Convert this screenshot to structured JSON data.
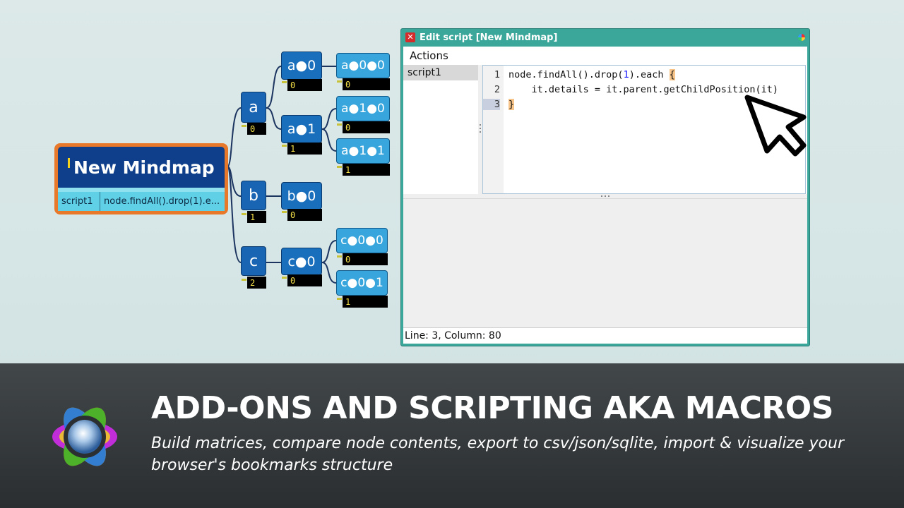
{
  "mindmap": {
    "root": {
      "title": "New Mindmap",
      "attr_key": "script1",
      "attr_value": "node.findAll().drop(1).e..."
    },
    "nodes": {
      "a": {
        "label": "a",
        "tag": "0"
      },
      "b": {
        "label": "b",
        "tag": "1"
      },
      "c": {
        "label": "c",
        "tag": "2"
      },
      "a0": {
        "label": "a●0",
        "tag": "0"
      },
      "a1": {
        "label": "a●1",
        "tag": "1"
      },
      "b0": {
        "label": "b●0",
        "tag": "0"
      },
      "c0": {
        "label": "c●0",
        "tag": "0"
      },
      "a00": {
        "label": "a●0●0",
        "tag": "0"
      },
      "a10": {
        "label": "a●1●0",
        "tag": "0"
      },
      "a11": {
        "label": "a●1●1",
        "tag": "1"
      },
      "c00": {
        "label": "c●0●0",
        "tag": "0"
      },
      "c01": {
        "label": "c●0●1",
        "tag": "1"
      }
    }
  },
  "editor": {
    "title": "Edit script [New Mindmap]",
    "menu": {
      "actions": "Actions"
    },
    "scripts": [
      "script1"
    ],
    "lines": [
      {
        "n": "1",
        "pre": "node.findAll().drop(",
        "num": "1",
        "post": ").each ",
        "brace": "{"
      },
      {
        "n": "2",
        "text": "    it.details = it.parent.getChildPosition(it)"
      },
      {
        "n": "3",
        "brace": "}"
      }
    ],
    "status": "Line: 3, Column: 80"
  },
  "banner": {
    "headline": "ADD-ONS AND SCRIPTING AKA MACROS",
    "subline": "Build matrices, compare node contents, export to csv/json/sqlite, import & visualize your browser's bookmarks structure"
  },
  "colors": {
    "root_border": "#e8792a",
    "root_fill": "#0f3f8a",
    "window_frame": "#3ba69a",
    "banner_bg": "#2f3335"
  }
}
